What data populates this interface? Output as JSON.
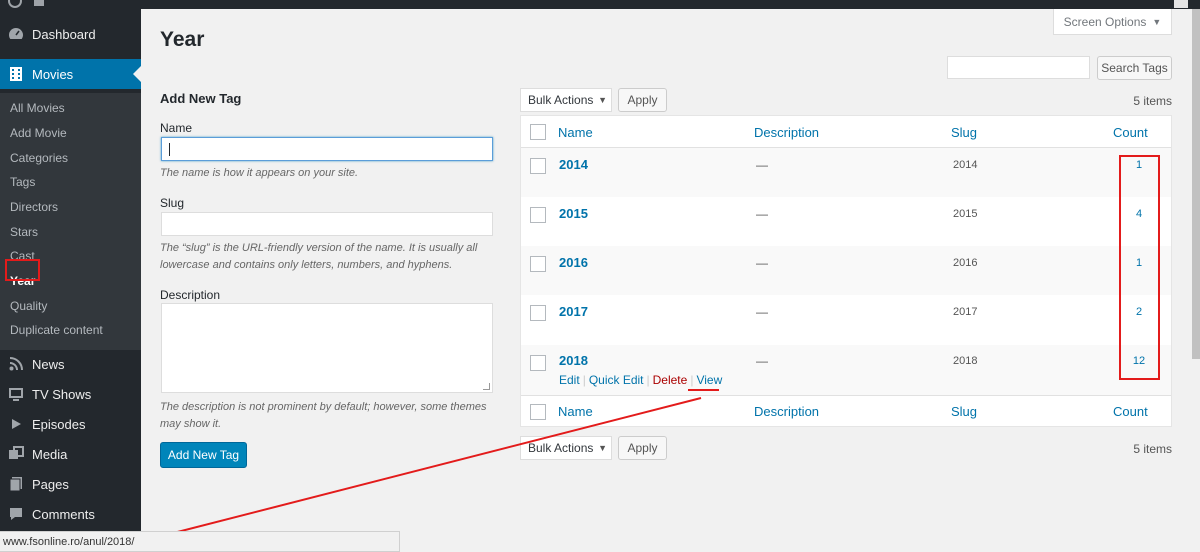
{
  "sidebar": {
    "top_items": [
      {
        "label": "Dashboard",
        "icon": "dashboard-icon"
      },
      {
        "label": "Movies",
        "icon": "film-icon"
      }
    ],
    "submenu": [
      "All Movies",
      "Add Movie",
      "Categories",
      "Tags",
      "Directors",
      "Stars",
      "Cast",
      "Year",
      "Quality",
      "Duplicate content"
    ],
    "bottom_items": [
      {
        "label": "News",
        "icon": "rss-icon"
      },
      {
        "label": "TV Shows",
        "icon": "tv-icon"
      },
      {
        "label": "Episodes",
        "icon": "play-icon"
      },
      {
        "label": "Media",
        "icon": "media-icon"
      },
      {
        "label": "Pages",
        "icon": "pages-icon"
      },
      {
        "label": "Comments",
        "icon": "comment-icon"
      }
    ]
  },
  "header": {
    "title": "Year",
    "screen_options": "Screen Options",
    "search_button": "Search Tags"
  },
  "form": {
    "heading": "Add New Tag",
    "name_label": "Name",
    "name_help": "The name is how it appears on your site.",
    "slug_label": "Slug",
    "slug_help": "The “slug” is the URL-friendly version of the name. It is usually all lowercase and contains only letters, numbers, and hyphens.",
    "description_label": "Description",
    "description_help": "The description is not prominent by default; however, some themes may show it.",
    "submit": "Add New Tag"
  },
  "table": {
    "bulk_actions": "Bulk Actions",
    "apply": "Apply",
    "items_count": "5 items",
    "columns": [
      "Name",
      "Description",
      "Slug",
      "Count"
    ],
    "rows": [
      {
        "name": "2014",
        "description": "—",
        "slug": "2014",
        "count": "1"
      },
      {
        "name": "2015",
        "description": "—",
        "slug": "2015",
        "count": "4"
      },
      {
        "name": "2016",
        "description": "—",
        "slug": "2016",
        "count": "1"
      },
      {
        "name": "2017",
        "description": "—",
        "slug": "2017",
        "count": "2"
      },
      {
        "name": "2018",
        "description": "—",
        "slug": "2018",
        "count": "12"
      }
    ],
    "row_actions": {
      "edit": "Edit",
      "quick_edit": "Quick Edit",
      "delete": "Delete",
      "view": "View"
    }
  },
  "status_url": "www.fsonline.ro/anul/2018/",
  "colors": {
    "accent": "#0073aa",
    "annotation": "#e31b1b",
    "sidebar": "#23282d"
  }
}
